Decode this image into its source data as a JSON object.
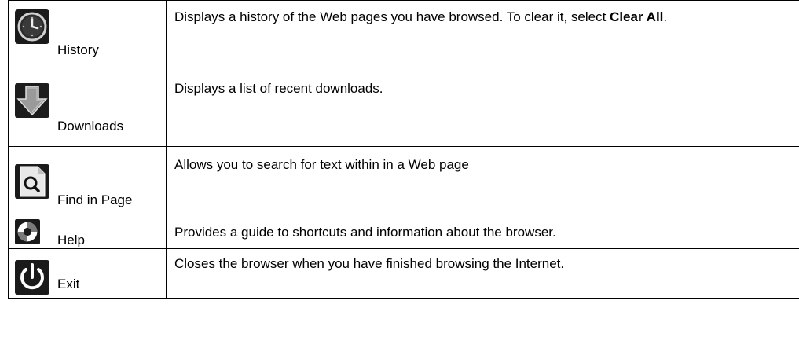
{
  "rows": [
    {
      "key": "history",
      "label": "History",
      "icon": "clock-icon",
      "desc_text": "Displays a history of the Web pages you have browsed. To clear it, select ",
      "desc_bold": "Clear All",
      "desc_end": "."
    },
    {
      "key": "downloads",
      "label": "Downloads",
      "icon": "download-arrow-icon",
      "desc_text": "Displays a list of recent downloads."
    },
    {
      "key": "find",
      "label": "Find in Page",
      "icon": "find-page-icon",
      "desc_text": "Allows you to search for text within in a Web page"
    },
    {
      "key": "help",
      "label": "Help",
      "icon": "lifebuoy-icon",
      "desc_text": "Provides a guide to shortcuts and information about the browser."
    },
    {
      "key": "exit",
      "label": "Exit",
      "icon": "power-icon",
      "desc_text": "Closes the browser when you have finished browsing the Internet."
    }
  ]
}
